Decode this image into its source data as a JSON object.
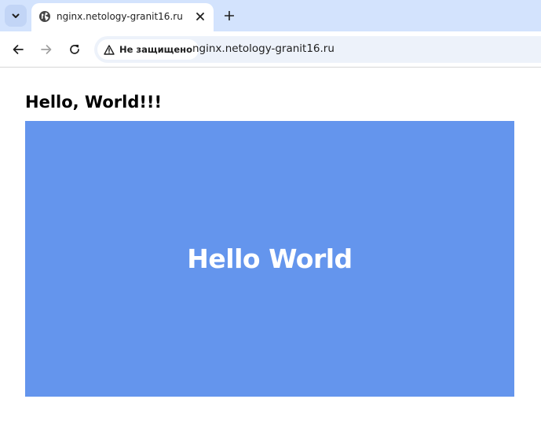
{
  "browser": {
    "tab": {
      "title": "nginx.netology-granit16.ru"
    },
    "address_bar": {
      "security_label": "Не защищено",
      "url": "nginx.netology-granit16.ru"
    },
    "icons": {
      "tab_menu": "chevron-down-icon",
      "favicon": "globe-icon",
      "close_tab": "close-icon",
      "new_tab": "plus-icon",
      "back": "arrow-left-icon",
      "forward": "arrow-right-icon",
      "reload": "reload-icon",
      "security": "warning-icon"
    },
    "colors": {
      "tabstrip": "#d3e3fd",
      "omnibox": "#edf2fa"
    }
  },
  "page": {
    "heading": "Hello, World!!!",
    "image": {
      "text": "Hello World",
      "background": "#6495ed"
    }
  }
}
